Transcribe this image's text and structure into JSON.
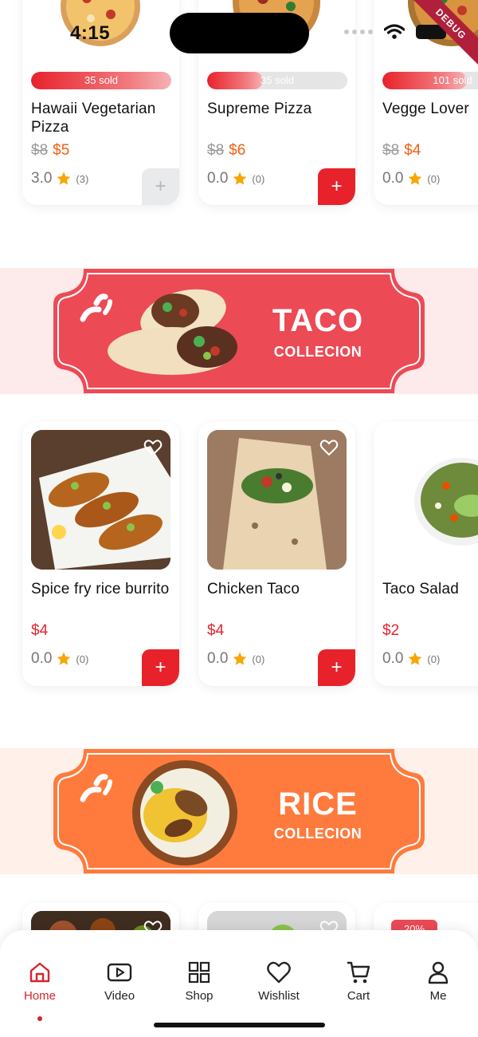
{
  "status_bar": {
    "time": "4:15",
    "debug_label": "DEBUG"
  },
  "pizza_row": {
    "items": [
      {
        "name": "Hawaii Vegetarian Pizza",
        "sold_label": "35 sold",
        "sold_fraction": 1.0,
        "price_old": "$8",
        "price_new": "$5",
        "rating": "3.0",
        "rating_count": "(3)",
        "add_label": "+",
        "add_enabled": false
      },
      {
        "name": "Supreme Pizza",
        "sold_label": "35 sold",
        "sold_fraction": 0.4,
        "price_old": "$8",
        "price_new": "$6",
        "rating": "0.0",
        "rating_count": "(0)",
        "add_label": "+",
        "add_enabled": true
      },
      {
        "name": "Vegge Lover",
        "sold_label": "101 sold",
        "sold_fraction": 0.6,
        "price_old": "$8",
        "price_new": "$4",
        "rating": "0.0",
        "rating_count": "(0)",
        "add_label": "+",
        "add_enabled": true
      }
    ]
  },
  "taco_banner": {
    "title": "TACO",
    "subtitle": "COLLECION",
    "color": "#ec4a55",
    "band_color": "#fdeaea"
  },
  "taco_row": {
    "items": [
      {
        "name": "Spice fry rice burrito",
        "price": "$4",
        "rating": "0.0",
        "rating_count": "(0)",
        "add_label": "+"
      },
      {
        "name": "Chicken Taco",
        "price": "$4",
        "rating": "0.0",
        "rating_count": "(0)",
        "add_label": "+"
      },
      {
        "name": "Taco Salad",
        "price": "$2",
        "rating": "0.0",
        "rating_count": "(0)",
        "add_label": "+"
      }
    ]
  },
  "rice_banner": {
    "title": "RICE",
    "subtitle": "COLLECION",
    "color": "#fe7b3d",
    "band_color": "#fff0ea"
  },
  "rice_row": {
    "discount_badge": "20%"
  },
  "bottom_nav": {
    "items": [
      {
        "label": "Home",
        "icon": "home-icon",
        "active": true
      },
      {
        "label": "Video",
        "icon": "video-icon",
        "active": false
      },
      {
        "label": "Shop",
        "icon": "grid-icon",
        "active": false
      },
      {
        "label": "Wishlist",
        "icon": "heart-icon",
        "active": false
      },
      {
        "label": "Cart",
        "icon": "cart-icon",
        "active": false
      },
      {
        "label": "Me",
        "icon": "user-icon",
        "active": false
      }
    ]
  },
  "colors": {
    "accent": "#e8222b",
    "price_red": "#e8222b",
    "price_orange": "#f06014",
    "star": "#f7a600",
    "active_nav": "#d6242b"
  }
}
